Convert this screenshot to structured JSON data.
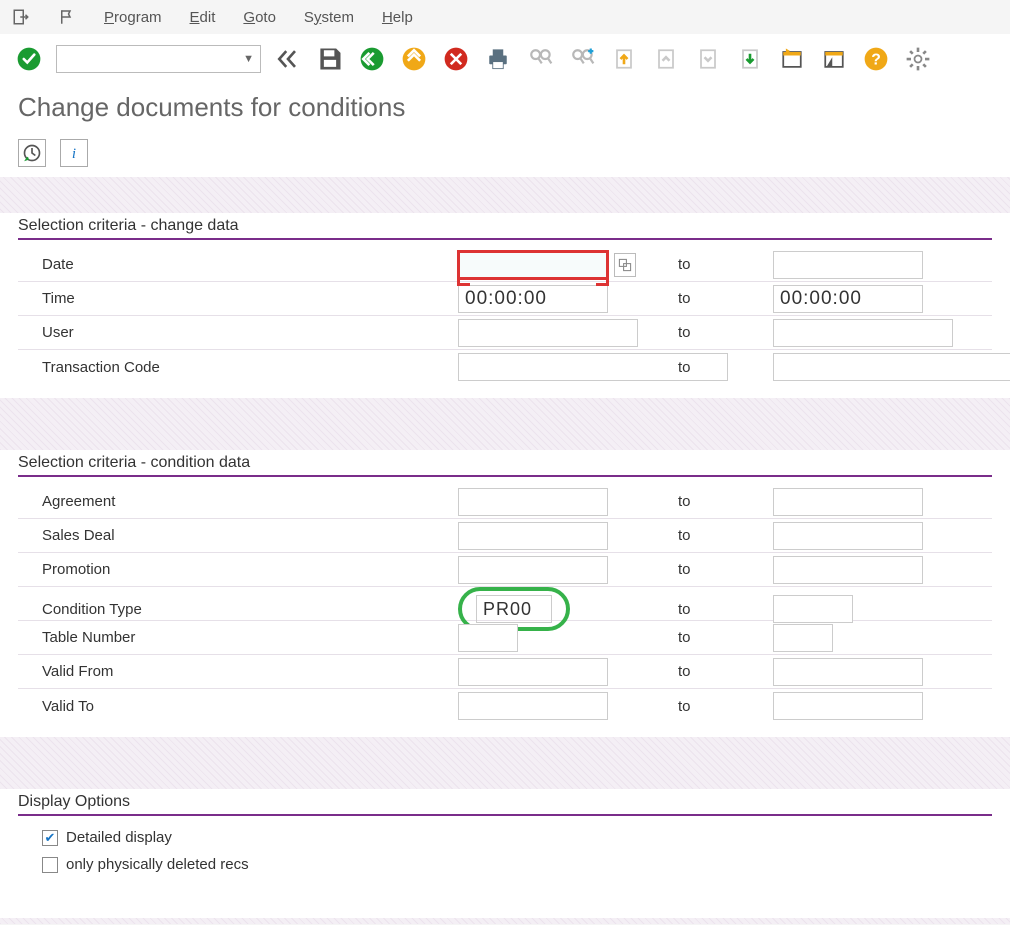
{
  "menu": {
    "program": "Program",
    "edit": "Edit",
    "goto": "Goto",
    "system": "System",
    "help": "Help"
  },
  "toolbar": {
    "command_value": ""
  },
  "page": {
    "title": "Change documents for conditions"
  },
  "sections": {
    "change_data": {
      "title": "Selection criteria - change data",
      "rows": {
        "date": {
          "label": "Date",
          "from": "",
          "to_label": "to",
          "to": ""
        },
        "time": {
          "label": "Time",
          "from": "00:00:00",
          "to_label": "to",
          "to": "00:00:00"
        },
        "user": {
          "label": "User",
          "from": "",
          "to_label": "to",
          "to": ""
        },
        "tcode": {
          "label": "Transaction Code",
          "from": "",
          "to_label": "to",
          "to": ""
        }
      }
    },
    "condition_data": {
      "title": "Selection criteria - condition data",
      "rows": {
        "agreement": {
          "label": "Agreement",
          "from": "",
          "to_label": "to",
          "to": ""
        },
        "sales_deal": {
          "label": "Sales Deal",
          "from": "",
          "to_label": "to",
          "to": ""
        },
        "promotion": {
          "label": "Promotion",
          "from": "",
          "to_label": "to",
          "to": ""
        },
        "cond_type": {
          "label": "Condition Type",
          "from": "PR00",
          "to_label": "to",
          "to": ""
        },
        "table_no": {
          "label": "Table Number",
          "from": "",
          "to_label": "to",
          "to": ""
        },
        "valid_from": {
          "label": "Valid From",
          "from": "",
          "to_label": "to",
          "to": ""
        },
        "valid_to": {
          "label": "Valid To",
          "from": "",
          "to_label": "to",
          "to": ""
        }
      }
    },
    "display_options": {
      "title": "Display Options",
      "detailed": {
        "label": "Detailed display",
        "checked": true
      },
      "deleted": {
        "label": "only physically deleted recs",
        "checked": false
      }
    }
  }
}
